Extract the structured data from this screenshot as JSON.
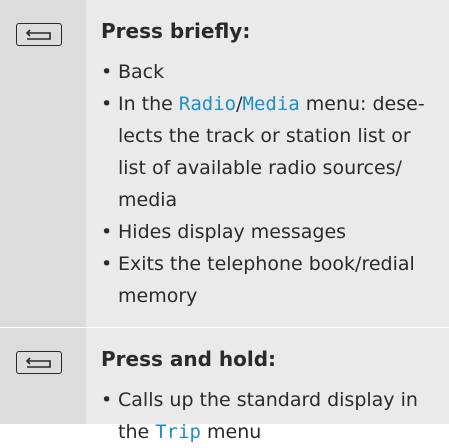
{
  "rows": [
    {
      "key_icon": "back-arrow-icon",
      "heading": "Press briefly:",
      "bullets": {
        "back": "Back",
        "radio_media": {
          "prefix": "In the ",
          "radio": "Radio",
          "slash": "/",
          "media": "Media",
          "line1_suffix": " menu: dese-",
          "line2": "lects the track or station list or",
          "line3": "list of available radio sources/",
          "line4": "media"
        },
        "hides": "Hides display messages",
        "exits": {
          "line1": "Exits the telephone book/redial",
          "line2": "memory"
        }
      }
    },
    {
      "key_icon": "back-arrow-icon",
      "heading": "Press and hold:",
      "bullets": {
        "calls": {
          "line1": "Calls up the standard display in",
          "prefix2": "the ",
          "trip": "Trip",
          "suffix2": " menu"
        }
      }
    }
  ],
  "bullet_char": "•",
  "colors": {
    "key_cell_bg": "#dcdcdc",
    "desc_cell_bg": "#eaeaea",
    "text": "#2a2a2a",
    "menu_term": "#1e8fc8"
  }
}
